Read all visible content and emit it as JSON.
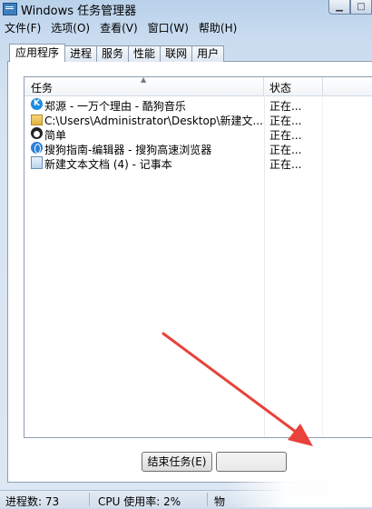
{
  "window": {
    "title": "Windows 任务管理器"
  },
  "caption_buttons": [
    "▁",
    "□",
    "✕"
  ],
  "menu": [
    "文件(F)",
    "选项(O)",
    "查看(V)",
    "窗口(W)",
    "帮助(H)"
  ],
  "tabs": [
    "应用程序",
    "进程",
    "服务",
    "性能",
    "联网",
    "用户"
  ],
  "active_tab": "应用程序",
  "listview": {
    "columns": {
      "task": "任务",
      "status": "状态"
    },
    "rows": [
      {
        "icon": "kugou-icon",
        "name": "郑源 - 一万个理由 - 酷狗音乐",
        "status": "正在..."
      },
      {
        "icon": "folder-icon",
        "name": "C:\\Users\\Administrator\\Desktop\\新建文...",
        "status": "正在..."
      },
      {
        "icon": "qq-icon",
        "name": "简单",
        "status": "正在..."
      },
      {
        "icon": "sogou-browser-icon",
        "name": "搜狗指南-编辑器 - 搜狗高速浏览器",
        "status": "正在..."
      },
      {
        "icon": "notepad-icon",
        "name": "新建文本文档 (4) - 记事本",
        "status": "正在..."
      }
    ]
  },
  "buttons": {
    "end_task": "结束任务(E)"
  },
  "statusbar": {
    "processes": "进程数: 73",
    "cpu": "CPU 使用率: 2%",
    "memory": "物"
  },
  "colors": {
    "arrow": "#e8423a",
    "accent": "#3f7fbf"
  }
}
